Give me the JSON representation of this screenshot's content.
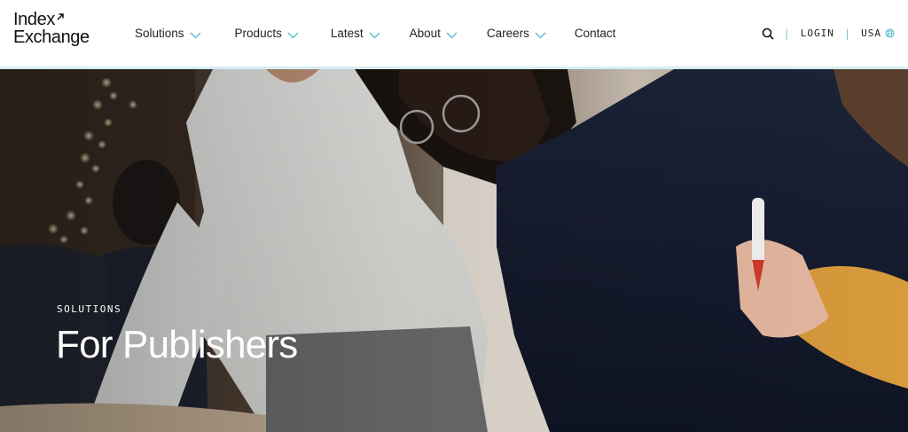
{
  "brand": {
    "logo_line1": "Index",
    "logo_line2": "Exchange",
    "logo_icon": "arrow-up-right-icon"
  },
  "nav": {
    "items": [
      {
        "label": "Solutions",
        "has_dropdown": true
      },
      {
        "label": "Products",
        "has_dropdown": true
      },
      {
        "label": "Latest",
        "has_dropdown": true
      },
      {
        "label": "About",
        "has_dropdown": true
      },
      {
        "label": "Careers",
        "has_dropdown": true
      },
      {
        "label": "Contact",
        "has_dropdown": false
      }
    ],
    "dropdown_icon": "chevron-down-icon"
  },
  "utils": {
    "search_icon": "search-icon",
    "login_label": "LOGIN",
    "country_label": "USA",
    "country_icon": "globe-icon"
  },
  "hero": {
    "eyebrow": "SOLUTIONS",
    "title": "For Publishers"
  },
  "colors": {
    "accent": "#5bbccc",
    "header_bg": "#ffffff",
    "header_border": "#d6eef3",
    "hero_text": "#ffffff"
  }
}
